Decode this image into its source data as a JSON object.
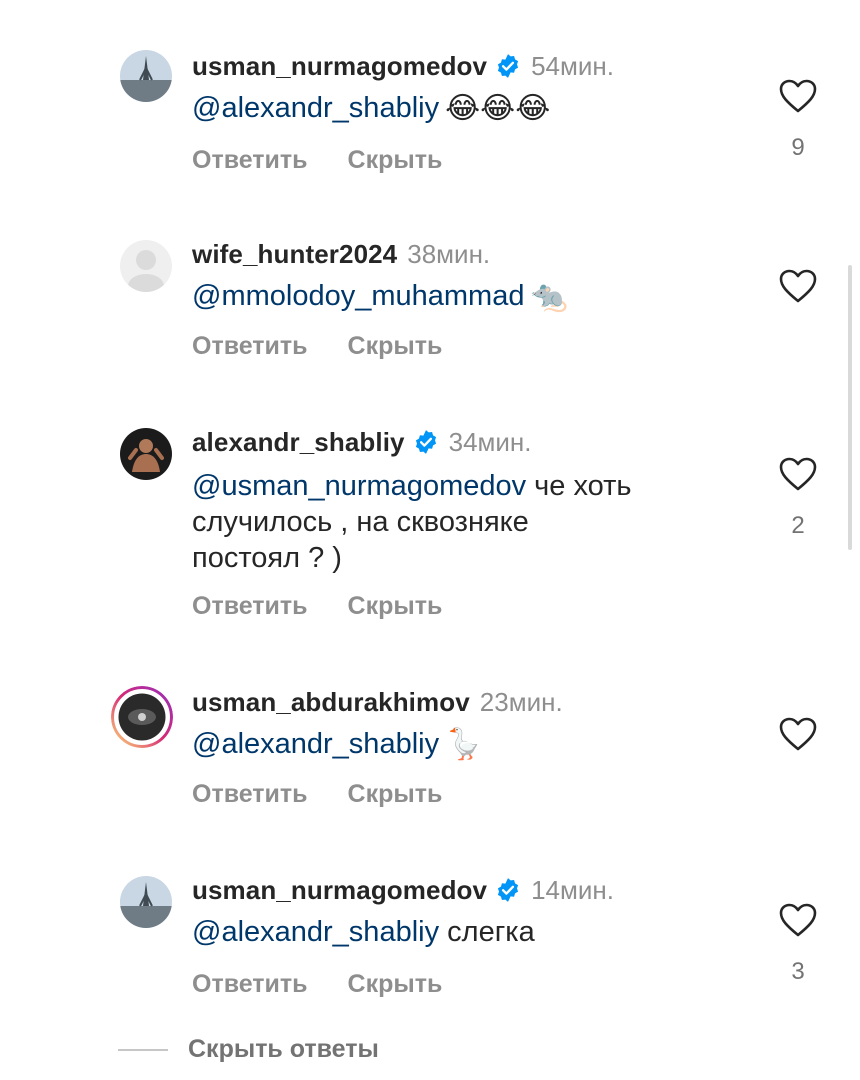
{
  "comments": [
    {
      "username": "usman_nurmagomedov",
      "verified": true,
      "time": "54мин.",
      "mention": "@alexandr_shabliy",
      "text": "",
      "emoji": "😂😂😂",
      "reply_label": "Ответить",
      "hide_label": "Скрыть",
      "likes": "9"
    },
    {
      "username": "wife_hunter2024",
      "verified": false,
      "time": "38мин.",
      "mention": "@mmolodoy_muhammad",
      "text": "",
      "emoji": "🐀",
      "reply_label": "Ответить",
      "hide_label": "Скрыть",
      "likes": ""
    },
    {
      "username": "alexandr_shabliy",
      "verified": true,
      "time": "34мин.",
      "mention": "@usman_nurmagomedov",
      "text_line1": " че хоть",
      "text_line2": "случилось , на сквозняке",
      "text_line3": "постоял ? )",
      "emoji": "",
      "reply_label": "Ответить",
      "hide_label": "Скрыть",
      "likes": "2"
    },
    {
      "username": "usman_abdurakhimov",
      "verified": false,
      "time": "23мин.",
      "mention": "@alexandr_shabliy",
      "text": "",
      "emoji": "🪿",
      "reply_label": "Ответить",
      "hide_label": "Скрыть",
      "likes": ""
    },
    {
      "username": "usman_nurmagomedov",
      "verified": true,
      "time": "14мин.",
      "mention": "@alexandr_shabliy",
      "text": " слегка",
      "emoji": "",
      "reply_label": "Ответить",
      "hide_label": "Скрыть",
      "likes": "3"
    }
  ],
  "hide_replies_label": "Скрыть ответы",
  "colors": {
    "mention": "#00376b",
    "verified": "#0095f6",
    "muted": "#8e8e8e"
  },
  "icons": {
    "like": "heart-outline-icon",
    "verified": "verified-badge-icon"
  }
}
